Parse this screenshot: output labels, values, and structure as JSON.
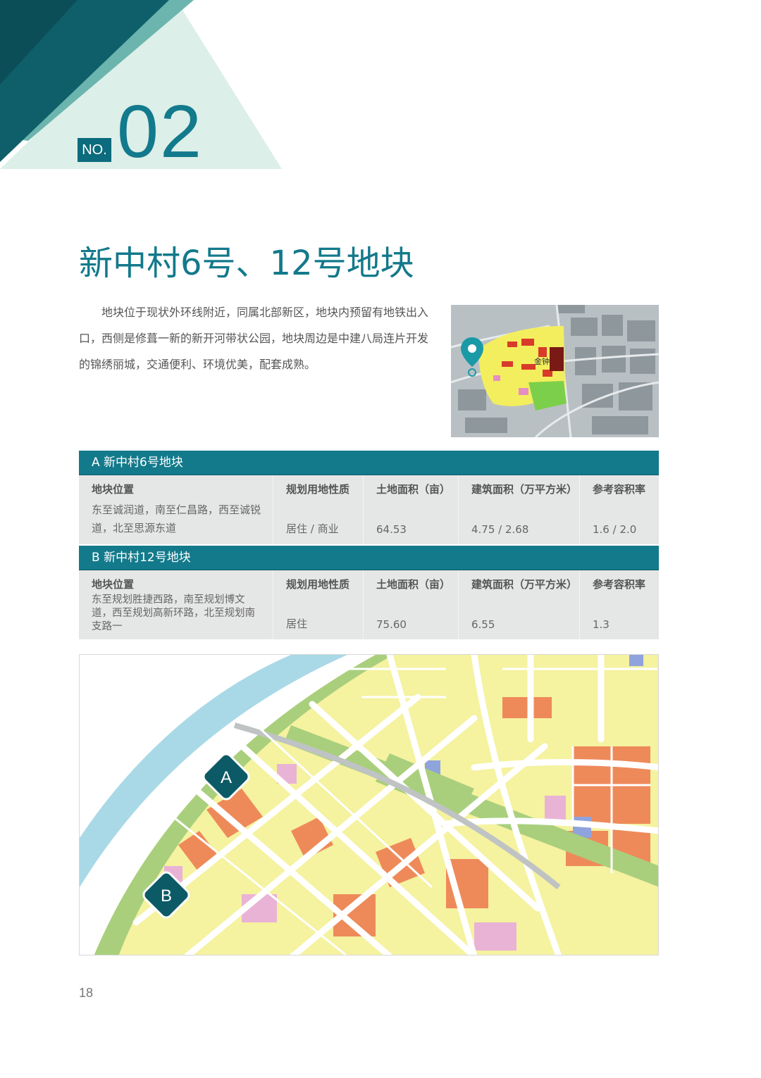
{
  "header": {
    "no_label": "NO.",
    "number": "02"
  },
  "title": "新中村6号、12号地块",
  "intro": "地块位于现状外环线附近，同属北部新区，地块内预留有地铁出入口，西侧是修葺一新的新开河带状公园，地块周边是中建八局连片开发的锦绣丽城，交通便利、环境优美，配套成熟。",
  "thumb_map": {
    "label": "金钟"
  },
  "columns": [
    "地块位置",
    "规划用地性质",
    "土地面积（亩）",
    "建筑面积（万平方米）",
    "参考容积率"
  ],
  "parcels": [
    {
      "header": "A 新中村6号地块",
      "location": "东至诚润道，南至仁昌路，西至诚锐道，北至思源东道",
      "land_use": "居住 / 商业",
      "land_area": "64.53",
      "floor_area": "4.75 / 2.68",
      "far": "1.6 / 2.0"
    },
    {
      "header": "B 新中村12号地块",
      "location": "东至规划胜捷西路，南至规划博文道，西至规划高新环路，北至规划南支路一",
      "land_use": "居住",
      "land_area": "75.60",
      "floor_area": "6.55",
      "far": "1.3"
    }
  ],
  "map": {
    "marker_a": "A",
    "marker_b": "B"
  },
  "page_number": "18",
  "colors": {
    "teal": "#137a8b",
    "dark_teal": "#0c5a66",
    "residential": "#f5f2a0",
    "commercial": "#ee8a5a",
    "green_space": "#a9cf7d",
    "education": "#e9b3d6",
    "water": "#a9d9e6"
  }
}
